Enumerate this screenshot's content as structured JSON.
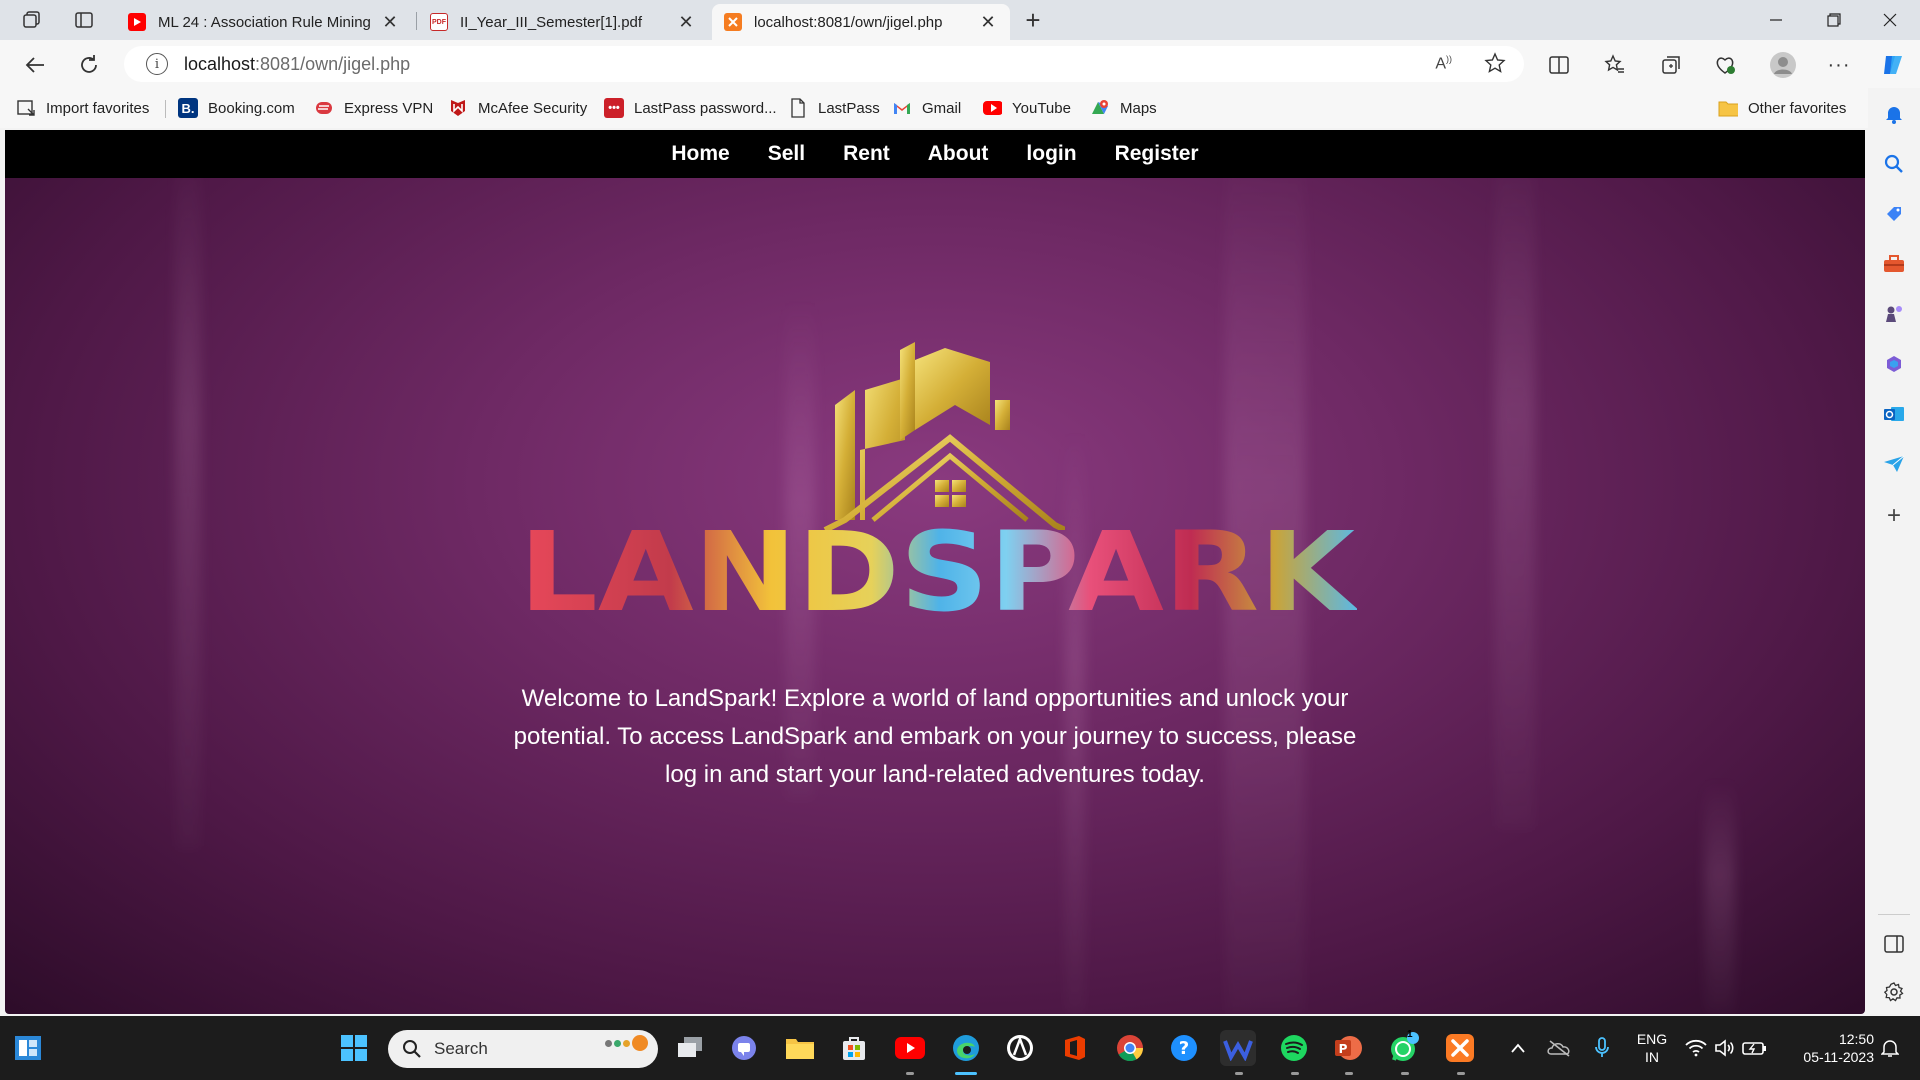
{
  "browser": {
    "tabs": [
      {
        "label": "ML 24 : Association Rule Mining",
        "favicon": "youtube-icon",
        "active": false
      },
      {
        "label": "II_Year_III_Semester[1].pdf",
        "favicon": "pdf-icon",
        "active": false
      },
      {
        "label": "localhost:8081/own/jigel.php",
        "favicon": "xampp-icon",
        "active": true
      }
    ],
    "url_host": "localhost",
    "url_path": ":8081/own/jigel.php",
    "favorites": [
      {
        "label": "Import favorites",
        "icon": "import-icon"
      },
      {
        "label": "Booking.com",
        "icon": "booking-icon"
      },
      {
        "label": "Express VPN",
        "icon": "expressvpn-icon"
      },
      {
        "label": "McAfee Security",
        "icon": "mcafee-icon"
      },
      {
        "label": "LastPass password...",
        "icon": "lastpass-icon"
      },
      {
        "label": "LastPass",
        "icon": "page-icon"
      },
      {
        "label": "Gmail",
        "icon": "gmail-icon"
      },
      {
        "label": "YouTube",
        "icon": "youtube-icon"
      },
      {
        "label": "Maps",
        "icon": "maps-icon"
      }
    ],
    "other_favorites": "Other favorites"
  },
  "page": {
    "nav": [
      "Home",
      "Sell",
      "Rent",
      "About",
      "login",
      "Register"
    ],
    "logo_text": "LANDSPARK",
    "welcome": "Welcome to LandSpark! Explore a world of land opportunities and unlock your potential. To access LandSpark and embark on your journey to success, please log in and start your land-related adventures today."
  },
  "taskbar": {
    "search_label": "Search",
    "language": "ENG",
    "region": "IN",
    "time": "12:50",
    "date": "05-11-2023",
    "whatsapp_badge": "1"
  },
  "colors": {
    "page_bg": "#6e2964",
    "nav_bg": "#000000",
    "logo_gold": "#d4af37"
  }
}
